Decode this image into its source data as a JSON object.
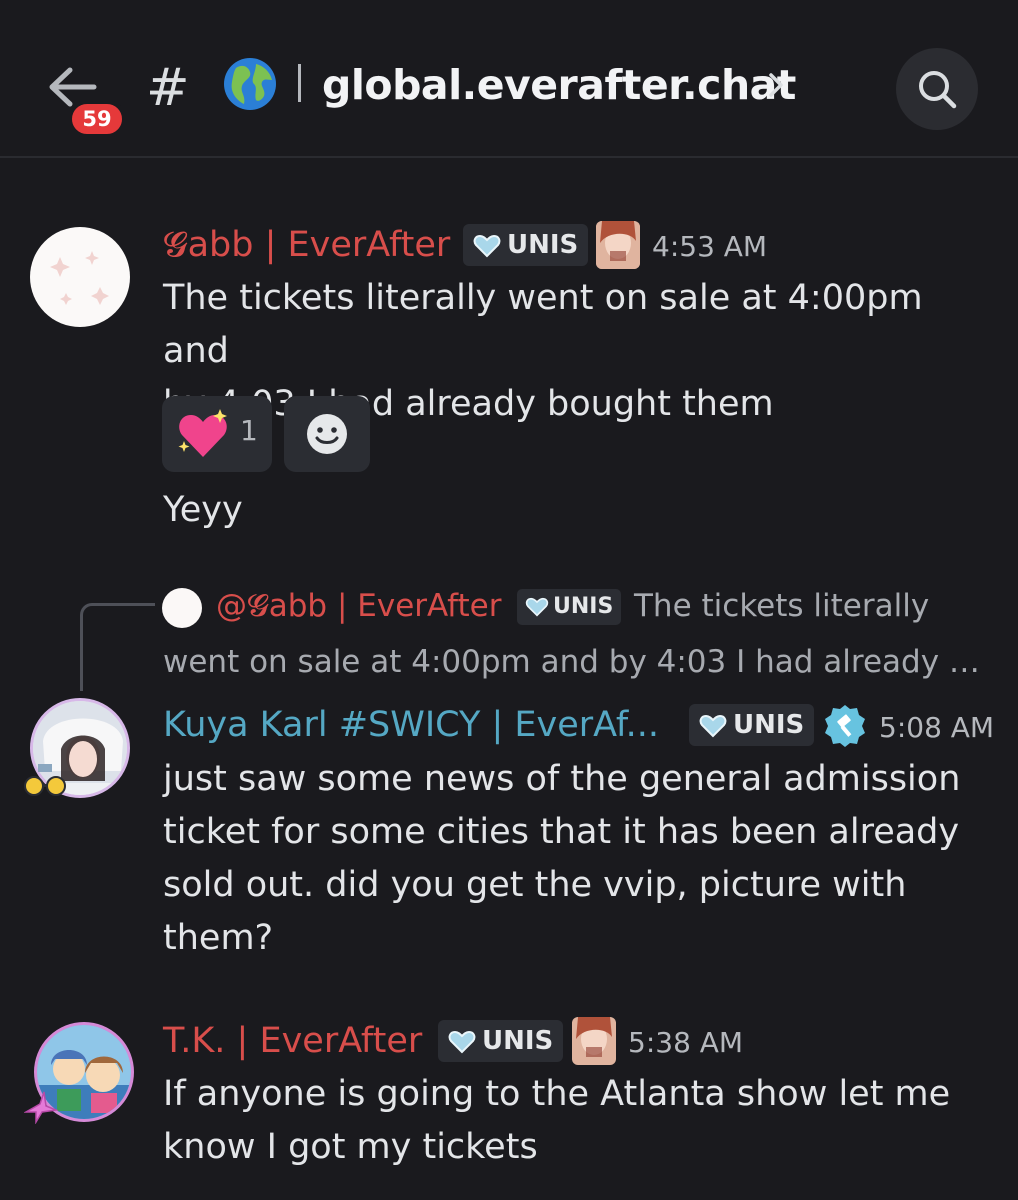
{
  "header": {
    "unread_count": "59",
    "channel_hash": "#",
    "channel_name": "global.everafter.chat",
    "globe_icon": "earth-globe-icon"
  },
  "messages": [
    {
      "author": "ɢabb | EverAfter",
      "author_display": "𝓖abb | EverAfter",
      "author_color": "#d84e4b",
      "tag": "UNIS",
      "time": "4:53 AM",
      "lines": [
        "The tickets literally went on sale at 4:00pm and",
        "by 4:03 I had already bought them"
      ],
      "reactions": [
        {
          "emoji": "sparkling-heart",
          "count": "1"
        }
      ],
      "followup": "Yeyy"
    },
    {
      "reply": {
        "author": "@𝓖abb | EverAfter",
        "tag": "UNIS",
        "text_line1": "The tickets literally",
        "text_line2": "went on sale at 4:00pm and by 4:03 I had already …"
      },
      "author": "Kuya Karl #SWICY | EverAf...",
      "author_color": "#55a8c4",
      "tag": "UNIS",
      "time": "5:08 AM",
      "lines": [
        "just saw some news of the general admission",
        "ticket for some cities that it has been already",
        "sold out. did you get the vvip, picture with",
        "them?"
      ]
    },
    {
      "author": "T.K. | EverAfter",
      "author_color": "#d84e4b",
      "tag": "UNIS",
      "time": "5:38 AM",
      "lines": [
        "If anyone is going to the Atlanta show let me",
        "know I got my tickets"
      ]
    }
  ]
}
